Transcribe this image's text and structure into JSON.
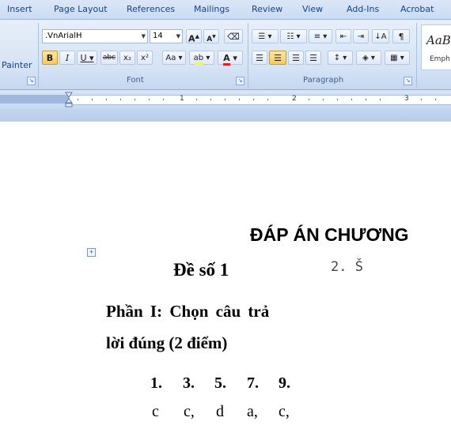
{
  "ribbon": {
    "tabs": [
      "Insert",
      "Page Layout",
      "References",
      "Mailings",
      "Review",
      "View",
      "Add-Ins",
      "Acrobat"
    ],
    "clipboard": {
      "painter_label": "Painter"
    },
    "font": {
      "name": ".VnArialH",
      "size": "14",
      "group_label": "Font"
    },
    "paragraph": {
      "group_label": "Paragraph"
    },
    "styles": {
      "preview_text": "AaB",
      "style_name": "Emph"
    }
  },
  "ruler": {
    "numbers": [
      "1",
      "2",
      "3"
    ]
  },
  "document": {
    "title": "ĐÁP ÁN CHƯƠNG",
    "exam_label": "Đề số 1",
    "side_note": "2. Š",
    "part_line1": "Phần I: Chọn câu trả",
    "part_line2": "lời đúng (2 điểm)",
    "answer_numbers": [
      "1.",
      "3.",
      "5.",
      "7.",
      "9."
    ],
    "answer_values": [
      "c",
      "c,",
      "d",
      "a,",
      "c,"
    ]
  },
  "colors": {
    "ribbon_text": "#15428b",
    "highlight": "#f8c95a",
    "font_color": "#e02020",
    "highlight_color": "#ffff00"
  }
}
